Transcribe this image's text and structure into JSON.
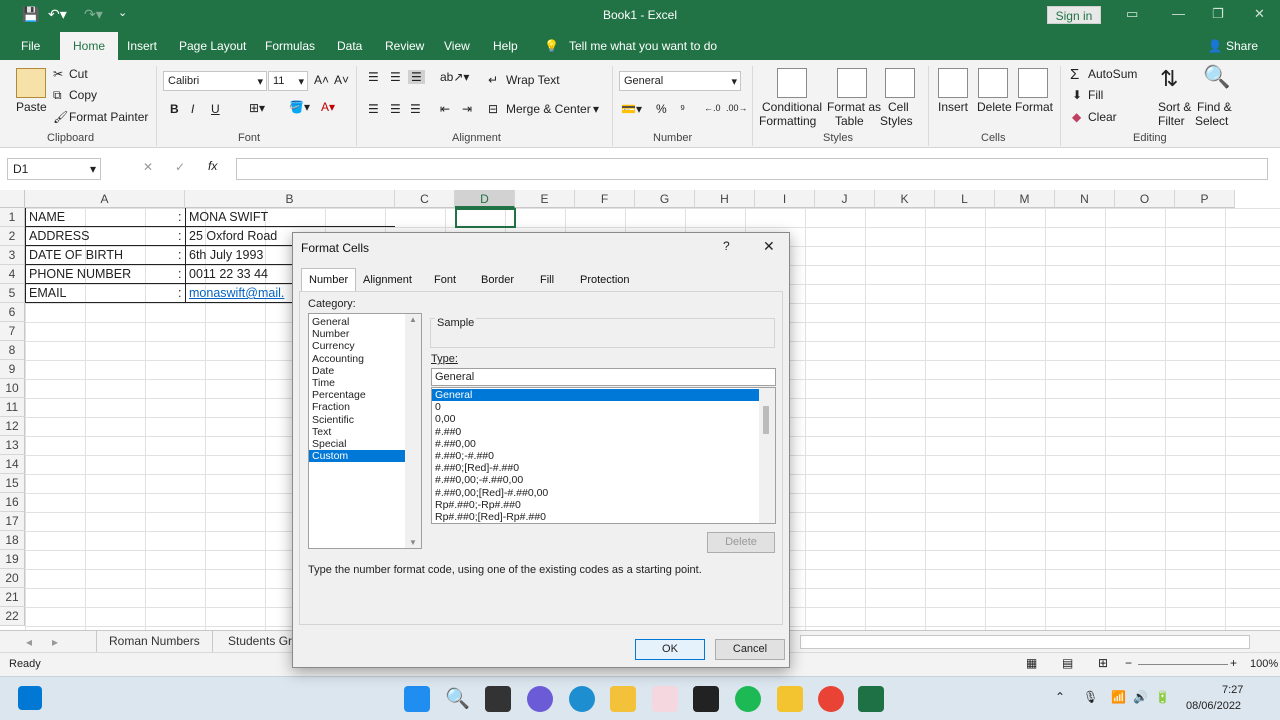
{
  "app": {
    "title": "Book1  -  Excel",
    "sign_in": "Sign in"
  },
  "menu": {
    "tabs": [
      "File",
      "Home",
      "Insert",
      "Page Layout",
      "Formulas",
      "Data",
      "Review",
      "View",
      "Help"
    ],
    "tell_me": "Tell me what you want to do",
    "share": "Share"
  },
  "ribbon": {
    "clipboard": {
      "paste": "Paste",
      "cut": "Cut",
      "copy": "Copy",
      "format_painter": "Format Painter",
      "label": "Clipboard"
    },
    "font": {
      "name": "Calibri",
      "size": "11",
      "label": "Font",
      "bold": "B",
      "italic": "I",
      "underline": "U"
    },
    "alignment": {
      "wrap_text": "Wrap Text",
      "merge_center": "Merge & Center",
      "label": "Alignment"
    },
    "number": {
      "format": "General",
      "label": "Number"
    },
    "styles": {
      "conditional": [
        "Conditional",
        "Formatting"
      ],
      "format_table": [
        "Format as",
        "Table"
      ],
      "cell_styles": [
        "Cell",
        "Styles"
      ],
      "label": "Styles"
    },
    "cells": {
      "insert": "Insert",
      "delete": "Delete",
      "format": "Format",
      "label": "Cells"
    },
    "editing": {
      "autosum": "AutoSum",
      "fill": "Fill",
      "clear": "Clear",
      "sort_filter": [
        "Sort &",
        "Filter"
      ],
      "find_select": [
        "Find &",
        "Select"
      ],
      "label": "Editing"
    }
  },
  "formula_bar": {
    "name_box": "D1",
    "fx": "fx",
    "value": ""
  },
  "grid": {
    "columns": [
      "A",
      "B",
      "C",
      "D",
      "E",
      "F",
      "G",
      "H",
      "I",
      "J",
      "K",
      "L",
      "M",
      "N",
      "O",
      "P"
    ],
    "rows": [
      "1",
      "2",
      "3",
      "4",
      "5",
      "6",
      "7",
      "8",
      "9",
      "10",
      "11",
      "12",
      "13",
      "14",
      "15",
      "16",
      "17",
      "18",
      "19",
      "20",
      "21",
      "22"
    ],
    "data": [
      {
        "a": "NAME",
        "colon": ":",
        "b": "MONA SWIFT"
      },
      {
        "a": "ADDRESS",
        "colon": ":",
        "b": "25 Oxford Road"
      },
      {
        "a": "DATE OF BIRTH",
        "colon": ":",
        "b": "6th July 1993"
      },
      {
        "a": "PHONE NUMBER",
        "colon": ":",
        "b": "0011 22 33 44"
      },
      {
        "a": "EMAIL",
        "colon": ":",
        "b": "monaswift@mail."
      }
    ]
  },
  "sheets": [
    "Roman Numbers",
    "Students Gr"
  ],
  "status": {
    "ready": "Ready",
    "zoom": "100%"
  },
  "dialog": {
    "title": "Format Cells",
    "help": "?",
    "close": "✕",
    "tabs": [
      "Number",
      "Alignment",
      "Font",
      "Border",
      "Fill",
      "Protection"
    ],
    "category_label": "Category:",
    "categories": [
      "General",
      "Number",
      "Currency",
      "Accounting",
      "Date",
      "Time",
      "Percentage",
      "Fraction",
      "Scientific",
      "Text",
      "Special",
      "Custom"
    ],
    "selected_category": "Custom",
    "sample_label": "Sample",
    "type_label": "Type:",
    "type_value": "General",
    "type_list": [
      "General",
      "0",
      "0,00",
      "#.##0",
      "#.##0,00",
      "#.##0;-#.##0",
      "#.##0;[Red]-#.##0",
      "#.##0,00;-#.##0,00",
      "#.##0,00;[Red]-#.##0,00",
      "Rp#.##0;-Rp#.##0",
      "Rp#.##0;[Red]-Rp#.##0"
    ],
    "delete": "Delete",
    "hint": "Type the number format code, using one of the existing codes as a starting point.",
    "ok": "OK",
    "cancel": "Cancel"
  },
  "taskbar": {
    "time": "7:27",
    "date": "08/06/2022"
  }
}
